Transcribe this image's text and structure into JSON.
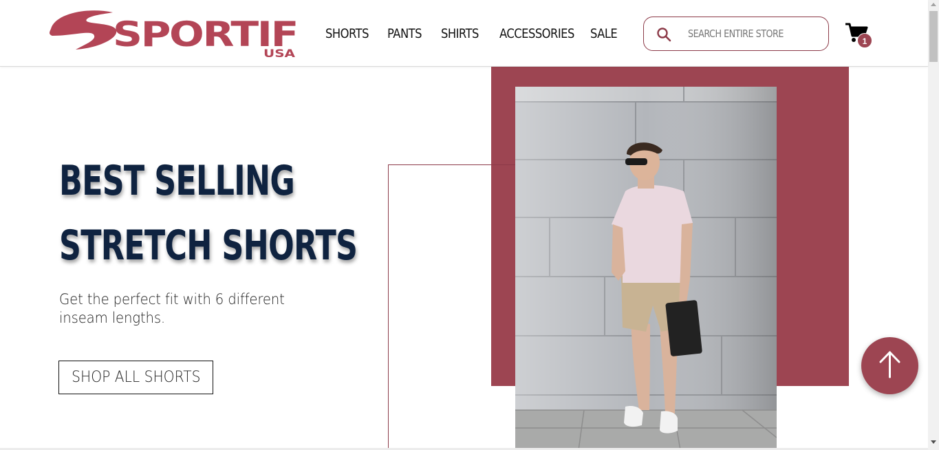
{
  "brand": {
    "name": "SPORTIF",
    "subtitle": "USA",
    "color": "#9d4552"
  },
  "nav": {
    "items": [
      {
        "label": "SHORTS"
      },
      {
        "label": "PANTS"
      },
      {
        "label": "SHIRTS"
      },
      {
        "label": "ACCESSORIES"
      },
      {
        "label": "SALE"
      }
    ]
  },
  "search": {
    "placeholder": "SEARCH ENTIRE STORE",
    "value": "",
    "icon": "search-icon"
  },
  "cart": {
    "count": "1",
    "icon": "cart-icon"
  },
  "hero": {
    "title_line1": "BEST SELLING",
    "title_line2": "STRETCH SHORTS",
    "subtitle": "Get the perfect fit with 6 different inseam lengths.",
    "cta_label": "SHOP ALL SHORTS",
    "title_color": "#0f2340",
    "accent_color": "#9d4552"
  },
  "scroll_top": {
    "icon": "arrow-up-icon"
  }
}
